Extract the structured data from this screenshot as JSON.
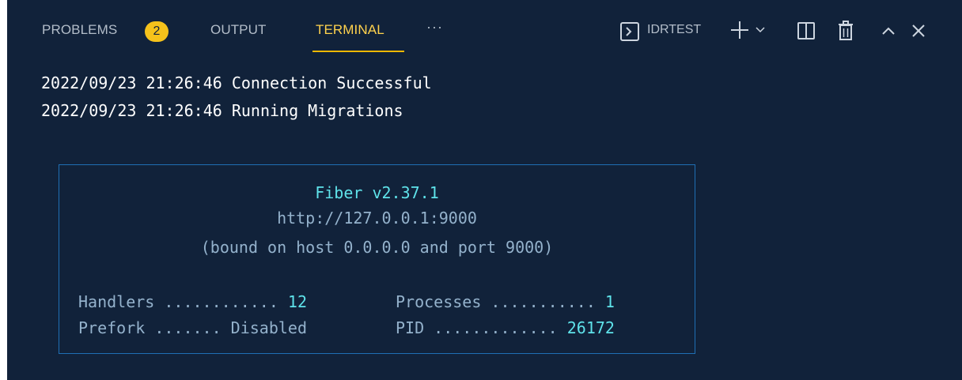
{
  "panel": {
    "tabs": [
      {
        "label": "PROBLEMS",
        "badge": "2"
      },
      {
        "label": "OUTPUT"
      },
      {
        "label": "TERMINAL",
        "active": true
      }
    ],
    "more_label": "···",
    "terminal_name": "IDRTEST",
    "icons": [
      "terminal-icon",
      "add-icon",
      "chevron-down-icon",
      "split-terminal-icon",
      "trash-icon",
      "chevron-up-icon",
      "close-icon"
    ],
    "colors": {
      "background": "#11223a",
      "active_tab": "#ffd24d",
      "badge": "#f5c21b",
      "accent_cyan": "#5fe3ea",
      "muted_text": "#94b2cc",
      "box_border": "#1f6fb4"
    }
  },
  "terminal": {
    "log": [
      "2022/09/23 21:26:46 Connection Successful",
      "2022/09/23 21:26:46 Running Migrations"
    ],
    "fiber_box": {
      "title": "Fiber v2.37.1",
      "url": "http://127.0.0.1:9000",
      "bound": "(bound on host 0.0.0.0 and port 9000)",
      "handlers_label": "Handlers ............ ",
      "handlers_value": "12",
      "prefork_label": "Prefork ....... ",
      "prefork_value": "Disabled",
      "processes_label": "Processes ........... ",
      "processes_value": "1",
      "pid_label": "PID ............. ",
      "pid_value": "26172"
    }
  }
}
